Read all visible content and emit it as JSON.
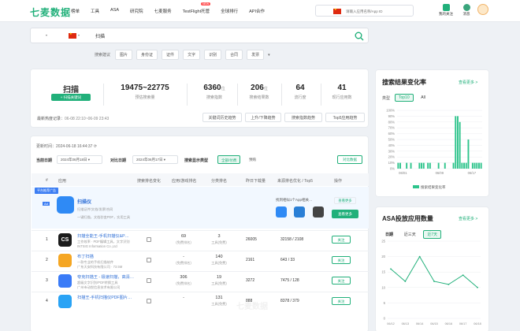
{
  "colors": {
    "brand": "#21b07a",
    "bar": "#2ec48c"
  },
  "header": {
    "logo": "七麦数据",
    "nav": [
      "榜单",
      "工具",
      "ASA",
      "研究院",
      "七麦服务",
      "TestFlight托管",
      "全球排行",
      "API合作"
    ],
    "nav_badge": "NEW",
    "search_placeholder": "请输入应用名称/App ID",
    "icons": [
      {
        "name": "vip-icon",
        "label": "我的关注"
      },
      {
        "name": "message-icon",
        "label": "消息"
      },
      {
        "name": "avatar",
        "label": "用户"
      }
    ]
  },
  "search": {
    "platform_icon": "apple-icon",
    "country": "china-flag",
    "query": "扫描",
    "suggest_label": "搜索建议",
    "suggestions": [
      "图片",
      "身份证",
      "证件",
      "文字",
      "识别",
      "合同",
      "发票"
    ]
  },
  "summary": {
    "keyword": "扫描",
    "add_btn": "+ 扫描关键词",
    "stats": [
      {
        "value": "19475~22775",
        "unit": "",
        "label": "预估搜索量"
      },
      {
        "value": "6360",
        "unit": "位",
        "label": "搜索指数"
      },
      {
        "value": "206",
        "unit": "位",
        "label": "搜索结果数"
      },
      {
        "value": "64",
        "unit": "",
        "label": "流行度"
      },
      {
        "value": "41",
        "unit": "",
        "label": "现行应用数"
      }
    ],
    "trend_label": "最新热度记录：",
    "trend_time": "06-08 22:10~06-09 23:43",
    "buttons": [
      "关键词历史趋势",
      "上升/下降趋势",
      "搜索指数趋势",
      "Top5应用趋势"
    ]
  },
  "table": {
    "updated_label": "更新时间：",
    "updated_time": "2024-06-18 16:44:37",
    "date_label": "当前日期",
    "date_value": "2024年06月18日",
    "compare_label": "对比日期",
    "compare_value": "2024年06月17日",
    "result_type_label": "搜索显示类型",
    "type_tabs": [
      "全部/付费",
      "预购"
    ],
    "compare_btn": "对比数据",
    "ad_label": "平台推荐广告",
    "headers": [
      "#",
      "应用",
      "搜索排名变化",
      "应用/游戏排名",
      "分类排名",
      "昨日下载量",
      "来源排名优化 / Top5",
      "操作"
    ],
    "ad_row": {
      "name": "扫描仪",
      "desc": "扫描证件/文档/发票/合同",
      "sub": "一键扫描，文档秒变PDF，实用工具",
      "more_text": "找到相似1个App相关…",
      "action": "查看更多"
    },
    "rows": [
      {
        "idx": "1",
        "name": "扫描全能王-手机扫描仪&P…",
        "dev": "工作效率 · PDF编辑工具，文字识别",
        "meta": "INTSIG Information Co.,Ltd",
        "rank": "69",
        "rank_sub": "(免费排名)",
        "cat": "3",
        "cat_sub": "工具(免费)",
        "dl": "26005",
        "src": "32158 / 2108",
        "action": "关注",
        "icon_label": "CS",
        "icon_color": "#1b1b1b"
      },
      {
        "idx": "2",
        "name": "布丁扫描",
        "dev": "一款专业的手机扫描软件",
        "meta": "广东天安科技有限公司 · 73.5M",
        "rank": "-",
        "rank_sub": "(免费排名)",
        "cat": "140",
        "cat_sub": "工具(免费)",
        "dl": "2161",
        "src": "643 / 33",
        "action": "关注",
        "icon_label": "",
        "icon_color": "#f5a623"
      },
      {
        "idx": "3",
        "name": "夸克扫描王 - 极速扫描，高清…",
        "dev": "超级文字识别/PDF转换工具",
        "meta": "广州市动悦信息技术有限公司",
        "rank": "306",
        "rank_sub": "(免费排名)",
        "cat": "19",
        "cat_sub": "工具(免费)",
        "dl": "3272",
        "src": "7475 / 128",
        "action": "关注",
        "icon_label": "",
        "icon_color": "#3a7bf7"
      },
      {
        "idx": "4",
        "name": "扫描王-手机扫描仪PDF图片…",
        "dev": "",
        "meta": "",
        "rank": "-",
        "rank_sub": "",
        "cat": "131",
        "cat_sub": "工具(免费)",
        "dl": "888",
        "src": "8378 / 379",
        "action": "关注",
        "icon_label": "",
        "icon_color": "#2aa3f5"
      }
    ],
    "watermark": "七麦数据"
  },
  "trend_card": {
    "title": "搜索结果变化率",
    "link": "查看更多 >",
    "type_label": "类型",
    "tabs": [
      "Top10",
      "All"
    ],
    "legend": "搜索结果变化率"
  },
  "asa_card": {
    "title": "ASA投放应用数量",
    "link": "查看更多 >",
    "tabs": [
      "日期",
      "近三天",
      "近7天"
    ]
  },
  "chart_data": [
    {
      "type": "bar",
      "title": "搜索结果变化率",
      "x_ticks": [
        "06/01",
        "06/09",
        "06/17"
      ],
      "ylim": [
        0,
        100
      ],
      "y_ticks": [
        "0%",
        "10%",
        "20%",
        "30%",
        "40%",
        "50%",
        "60%",
        "70%",
        "80%",
        "90%",
        "100%"
      ],
      "series": [
        {
          "name": "搜索结果变化率",
          "values": [
            10,
            10,
            0,
            0,
            10,
            0,
            10,
            0,
            0,
            0,
            10,
            10,
            10,
            0,
            10,
            10,
            0,
            0,
            0,
            10,
            0,
            0,
            10,
            0,
            0,
            0,
            10,
            90,
            90,
            80,
            10,
            10,
            10,
            50,
            0,
            10,
            10,
            10,
            10,
            10
          ]
        }
      ],
      "grid": true,
      "legend": "bottom"
    },
    {
      "type": "line",
      "title": "ASA投放应用数量",
      "x_ticks": [
        "06/12",
        "06/13",
        "06/14",
        "06/15",
        "06/16",
        "06/17",
        "06/18"
      ],
      "ylim": [
        0,
        25
      ],
      "y_ticks": [
        "0",
        "5",
        "10",
        "15",
        "20",
        "25"
      ],
      "series": [
        {
          "name": "",
          "values": [
            16,
            12,
            20,
            12,
            11,
            14,
            10
          ]
        }
      ],
      "grid": true
    }
  ]
}
